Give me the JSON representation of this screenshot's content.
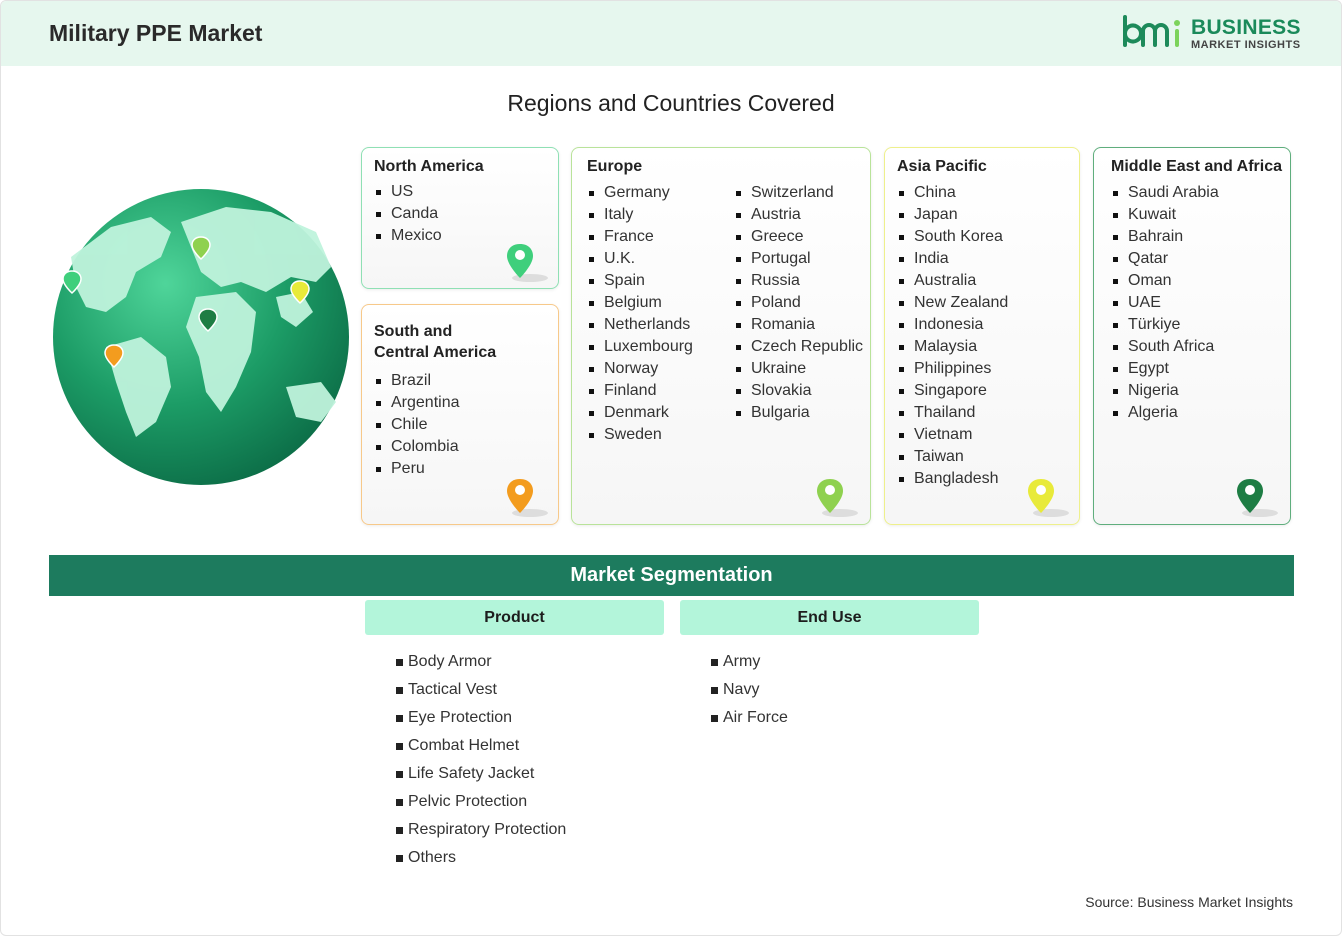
{
  "header": {
    "title": "Military PPE Market",
    "logo": {
      "line1": "BUSINESS",
      "line2": "MARKET INSIGHTS",
      "icon": "bmi-logo-icon"
    }
  },
  "regions": {
    "title": "Regions and Countries Covered",
    "north_america": {
      "title": "North America",
      "items": [
        "US",
        "Canda",
        "Mexico"
      ],
      "color": "#3fcf7c"
    },
    "south_central_america": {
      "title_line1": "South and",
      "title_line2": "Central America",
      "items": [
        "Brazil",
        "Argentina",
        "Chile",
        "Colombia",
        "Peru"
      ],
      "color": "#f39c1e"
    },
    "europe": {
      "title": "Europe",
      "col1": [
        "Germany",
        "Italy",
        "France",
        "U.K.",
        "Spain",
        "Belgium",
        "Netherlands",
        "Luxembourg",
        "Norway",
        "Finland",
        "Denmark",
        "Sweden"
      ],
      "col2": [
        "Switzerland",
        "Austria",
        "Greece",
        "Portugal",
        "Russia",
        "Poland",
        "Romania",
        "Czech Republic",
        "Ukraine",
        "Slovakia",
        "Bulgaria"
      ],
      "color": "#8fd14f"
    },
    "asia_pacific": {
      "title": "Asia Pacific",
      "items": [
        "China",
        "Japan",
        "South Korea",
        "India",
        "Australia",
        "New Zealand",
        "Indonesia",
        "Malaysia",
        "Philippines",
        "Singapore",
        "Thailand",
        "Vietnam",
        "Taiwan",
        "Bangladesh"
      ],
      "color": "#e8ea3a"
    },
    "middle_east_africa": {
      "title": "Middle East and Africa",
      "items": [
        "Saudi Arabia",
        "Kuwait",
        "Bahrain",
        "Qatar",
        "Oman",
        "UAE",
        "Türkiye",
        "South Africa",
        "Egypt",
        "Nigeria",
        "Algeria"
      ],
      "color": "#1e7d44"
    }
  },
  "segmentation": {
    "title": "Market Segmentation",
    "product": {
      "label": "Product",
      "items": [
        "Body Armor",
        "Tactical Vest",
        "Eye Protection",
        "Combat Helmet",
        "Life Safety Jacket",
        "Pelvic Protection",
        "Respiratory Protection",
        "Others"
      ]
    },
    "end_use": {
      "label": "End Use",
      "items": [
        "Army",
        "Navy",
        "Air Force"
      ]
    }
  },
  "source": "Source: Business Market Insights"
}
